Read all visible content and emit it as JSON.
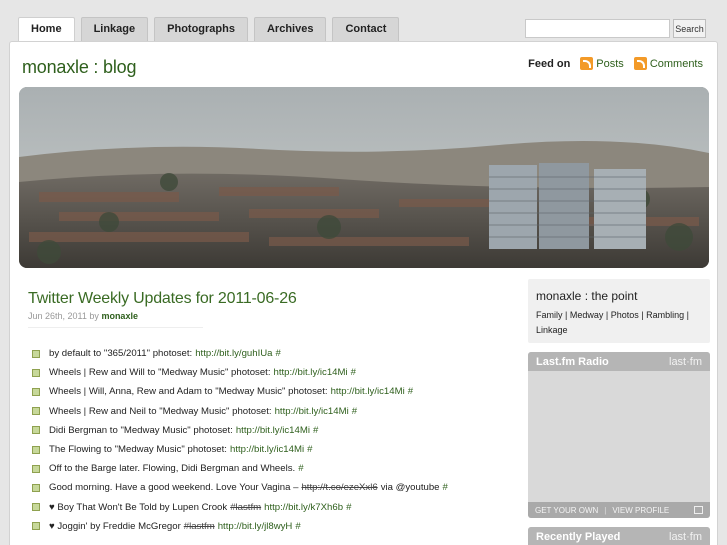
{
  "nav": {
    "tabs": [
      {
        "label": "Home"
      },
      {
        "label": "Linkage"
      },
      {
        "label": "Photographs"
      },
      {
        "label": "Archives"
      },
      {
        "label": "Contact"
      }
    ]
  },
  "search": {
    "value": "",
    "button_label": "Search"
  },
  "header": {
    "site_title": "monaxle : blog",
    "feed_label": "Feed on",
    "feed_posts": "Posts",
    "feed_comments": "Comments"
  },
  "post": {
    "title": "Twitter Weekly Updates for 2011-06-26",
    "date": "Jun 26th, 2011",
    "by": "by",
    "author": "monaxle",
    "items": [
      {
        "text": "by default to \"365/2011\" photoset:",
        "link": "http://bit.ly/guhIUa",
        "hash": "#"
      },
      {
        "text": "Wheels | Rew and Will to \"Medway Music\" photoset:",
        "link": "http://bit.ly/ic14Mi",
        "hash": "#"
      },
      {
        "text": "Wheels | Will, Anna, Rew and Adam to \"Medway Music\" photoset:",
        "link": "http://bit.ly/ic14Mi",
        "hash": "#"
      },
      {
        "text": "Wheels | Rew and Neil to \"Medway Music\" photoset:",
        "link": "http://bit.ly/ic14Mi",
        "hash": "#"
      },
      {
        "text": "Didi Bergman to \"Medway Music\" photoset:",
        "link": "http://bit.ly/ic14Mi",
        "hash": "#"
      },
      {
        "text": "The Flowing to \"Medway Music\" photoset:",
        "link": "http://bit.ly/ic14Mi",
        "hash": "#"
      },
      {
        "text": "Off to the Barge later. Flowing, Didi Bergman and Wheels.",
        "link": "",
        "hash": "#"
      },
      {
        "text": "Good morning. Have a good weekend. Love Your Vagina –",
        "strike": "http://t.co/ezeXxl6",
        "after": "via @youtube",
        "hash": "#"
      },
      {
        "text": "♥ Boy That Won't Be Told by Lupen Crook",
        "strike": "#lastfm",
        "link": "http://bit.ly/k7Xh6b",
        "hash": "#"
      },
      {
        "text": "♥ Joggin' by Freddie McGregor",
        "strike": "#lastfm",
        "link": "http://bit.ly/jl8wyH",
        "hash": "#"
      }
    ]
  },
  "sidebar": {
    "point_title": "monaxle : the point",
    "point_links": [
      "Family",
      "Medway",
      "Photos",
      "Rambling",
      "Linkage"
    ],
    "lastfm_radio_title": "Last.fm Radio",
    "lastfm_logo": "last·fm",
    "lastfm_get": "GET YOUR OWN",
    "lastfm_view": "VIEW PROFILE",
    "recent_title": "Recently Played",
    "recent_logo": "last·fm"
  }
}
